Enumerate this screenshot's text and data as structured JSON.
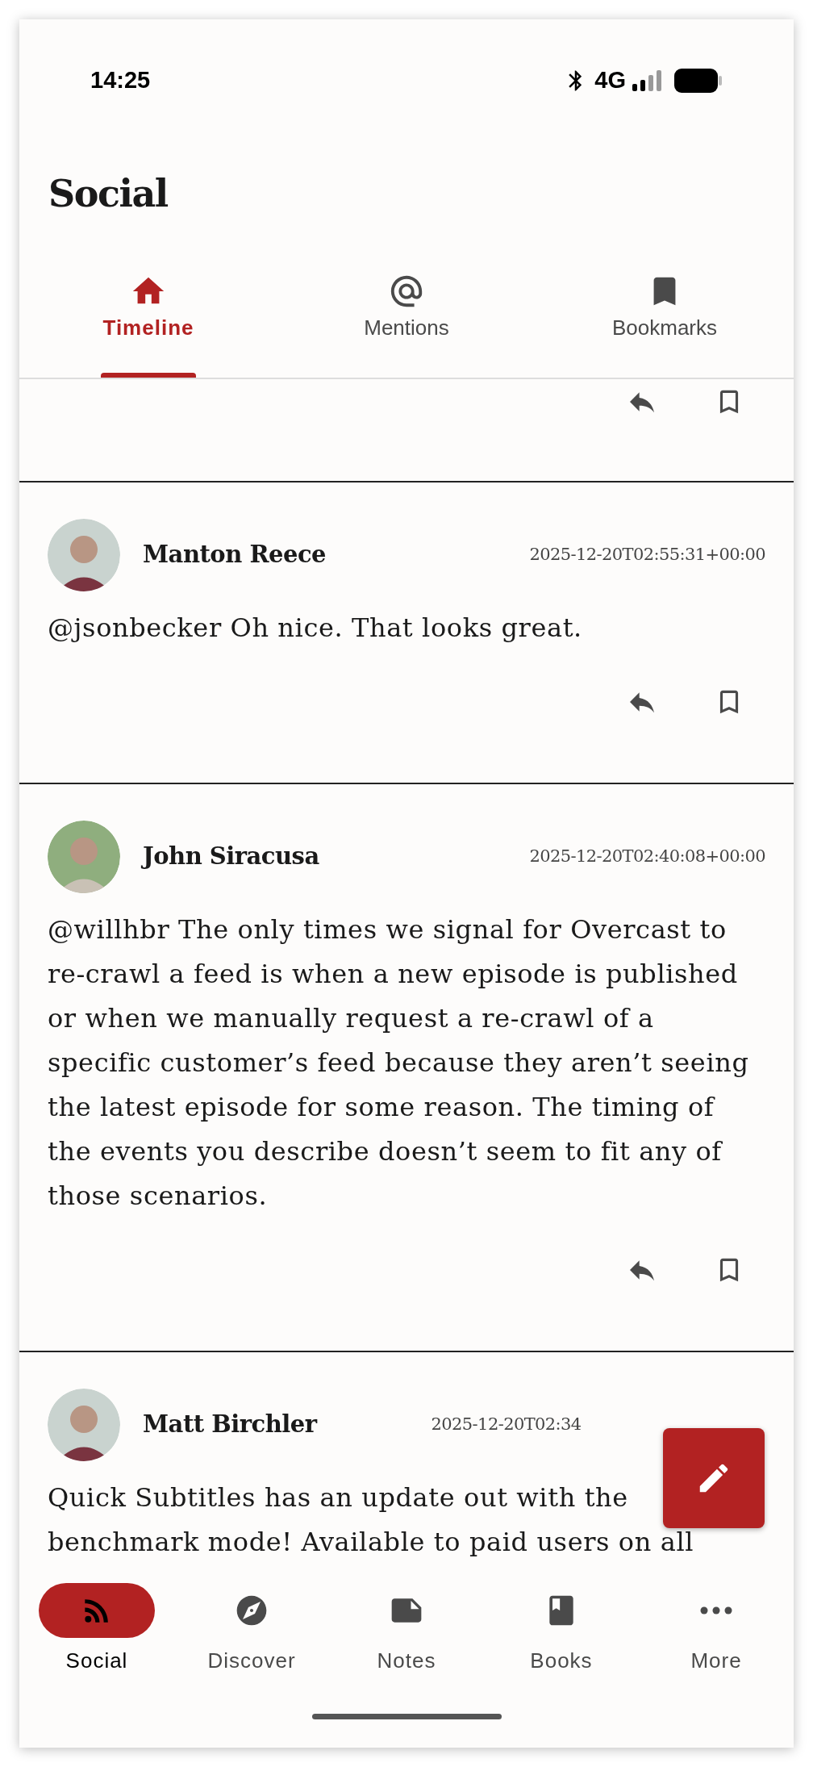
{
  "status_bar": {
    "time": "14:25",
    "network": "4G"
  },
  "title": "Social",
  "tabs": [
    {
      "label": "Timeline",
      "selected": true
    },
    {
      "label": "Mentions",
      "selected": false
    },
    {
      "label": "Bookmarks",
      "selected": false
    }
  ],
  "posts": [
    {
      "kind": "partial",
      "bookmarked": false
    },
    {
      "kind": "post",
      "author": "Manton Reece",
      "time": "2025-12-20T02:55:31+00:00",
      "body": "@jsonbecker Oh nice. That looks great.",
      "bookmarked": false
    },
    {
      "kind": "post",
      "author": "John Siracusa",
      "time": "2025-12-20T02:40:08+00:00",
      "body": "@willhbr The only times we signal for Overcast to re-crawl a feed is when a new episode is published or when we manually request a re-crawl of a specific customer’s feed because they aren’t seeing the latest episode for some reason. The timing of the events you describe doesn’t seem to fit any of those scenarios.",
      "bookmarked": false
    },
    {
      "kind": "clipped",
      "author": "Matt Birchler",
      "time": "2025-12-20T02:34",
      "lines": [
        "Quick Subtitles has an update out with the",
        "benchmark mode! Available to paid users on all"
      ]
    }
  ],
  "nav": [
    {
      "label": "Social",
      "selected": true
    },
    {
      "label": "Discover",
      "selected": false
    },
    {
      "label": "Notes",
      "selected": false
    },
    {
      "label": "Books",
      "selected": false
    },
    {
      "label": "More",
      "selected": false
    }
  ]
}
